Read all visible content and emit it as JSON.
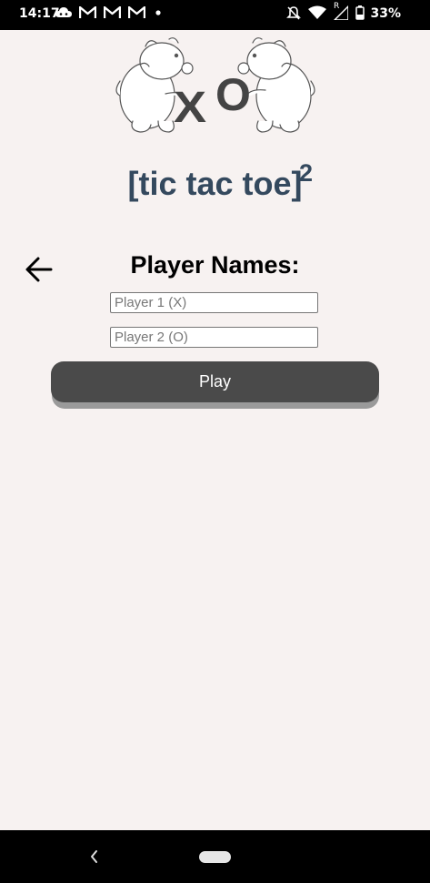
{
  "status_bar": {
    "time": "14:17",
    "battery_text": "33%",
    "left_icons": [
      "cloud-icon",
      "gmail-icon",
      "gmail-icon",
      "gmail-icon",
      "dot-icon"
    ],
    "right_icons": [
      "mute-icon",
      "wifi-icon",
      "signal-icon",
      "battery-icon"
    ],
    "signal_label": "R"
  },
  "logo": {
    "x_letter": "X",
    "o_letter": "O"
  },
  "title": {
    "main": "[tic tac toe]",
    "superscript": "2"
  },
  "setup": {
    "heading": "Player Names:",
    "player1_placeholder": "Player 1 (X)",
    "player1_value": "",
    "player2_placeholder": "Player 2 (O)",
    "player2_value": "",
    "play_label": "Play"
  },
  "colors": {
    "background": "#f7f2f1",
    "title": "#34495e",
    "button": "#4a4a4a"
  }
}
